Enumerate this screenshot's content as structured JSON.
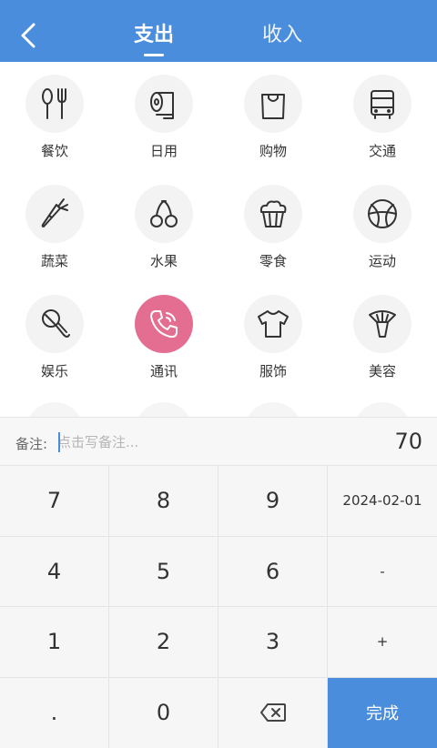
{
  "header": {
    "tabs": [
      {
        "label": "支出",
        "active": true
      },
      {
        "label": "收入",
        "active": false
      }
    ]
  },
  "categories": [
    {
      "label": "餐饮",
      "icon": "fork-spoon-icon"
    },
    {
      "label": "日用",
      "icon": "tissue-roll-icon"
    },
    {
      "label": "购物",
      "icon": "shopping-bag-icon"
    },
    {
      "label": "交通",
      "icon": "bus-icon"
    },
    {
      "label": "蔬菜",
      "icon": "carrot-icon"
    },
    {
      "label": "水果",
      "icon": "cherry-icon"
    },
    {
      "label": "零食",
      "icon": "cupcake-icon"
    },
    {
      "label": "运动",
      "icon": "basketball-icon"
    },
    {
      "label": "娱乐",
      "icon": "microphone-icon"
    },
    {
      "label": "通讯",
      "icon": "phone-icon",
      "selected": true
    },
    {
      "label": "服饰",
      "icon": "tshirt-icon"
    },
    {
      "label": "美容",
      "icon": "hair-dryer-icon"
    }
  ],
  "note": {
    "label": "备注:",
    "placeholder": "点击写备注...",
    "value": ""
  },
  "amount": "70",
  "keypad": {
    "rows": [
      [
        "7",
        "8",
        "9",
        "2024-02-01"
      ],
      [
        "4",
        "5",
        "6",
        "-"
      ],
      [
        "1",
        "2",
        "3",
        "+"
      ],
      [
        ".",
        "0",
        "backspace",
        "完成"
      ]
    ]
  },
  "colors": {
    "primary": "#4a8ddc",
    "selected": "#e36e91",
    "icon_stroke": "#333333"
  }
}
